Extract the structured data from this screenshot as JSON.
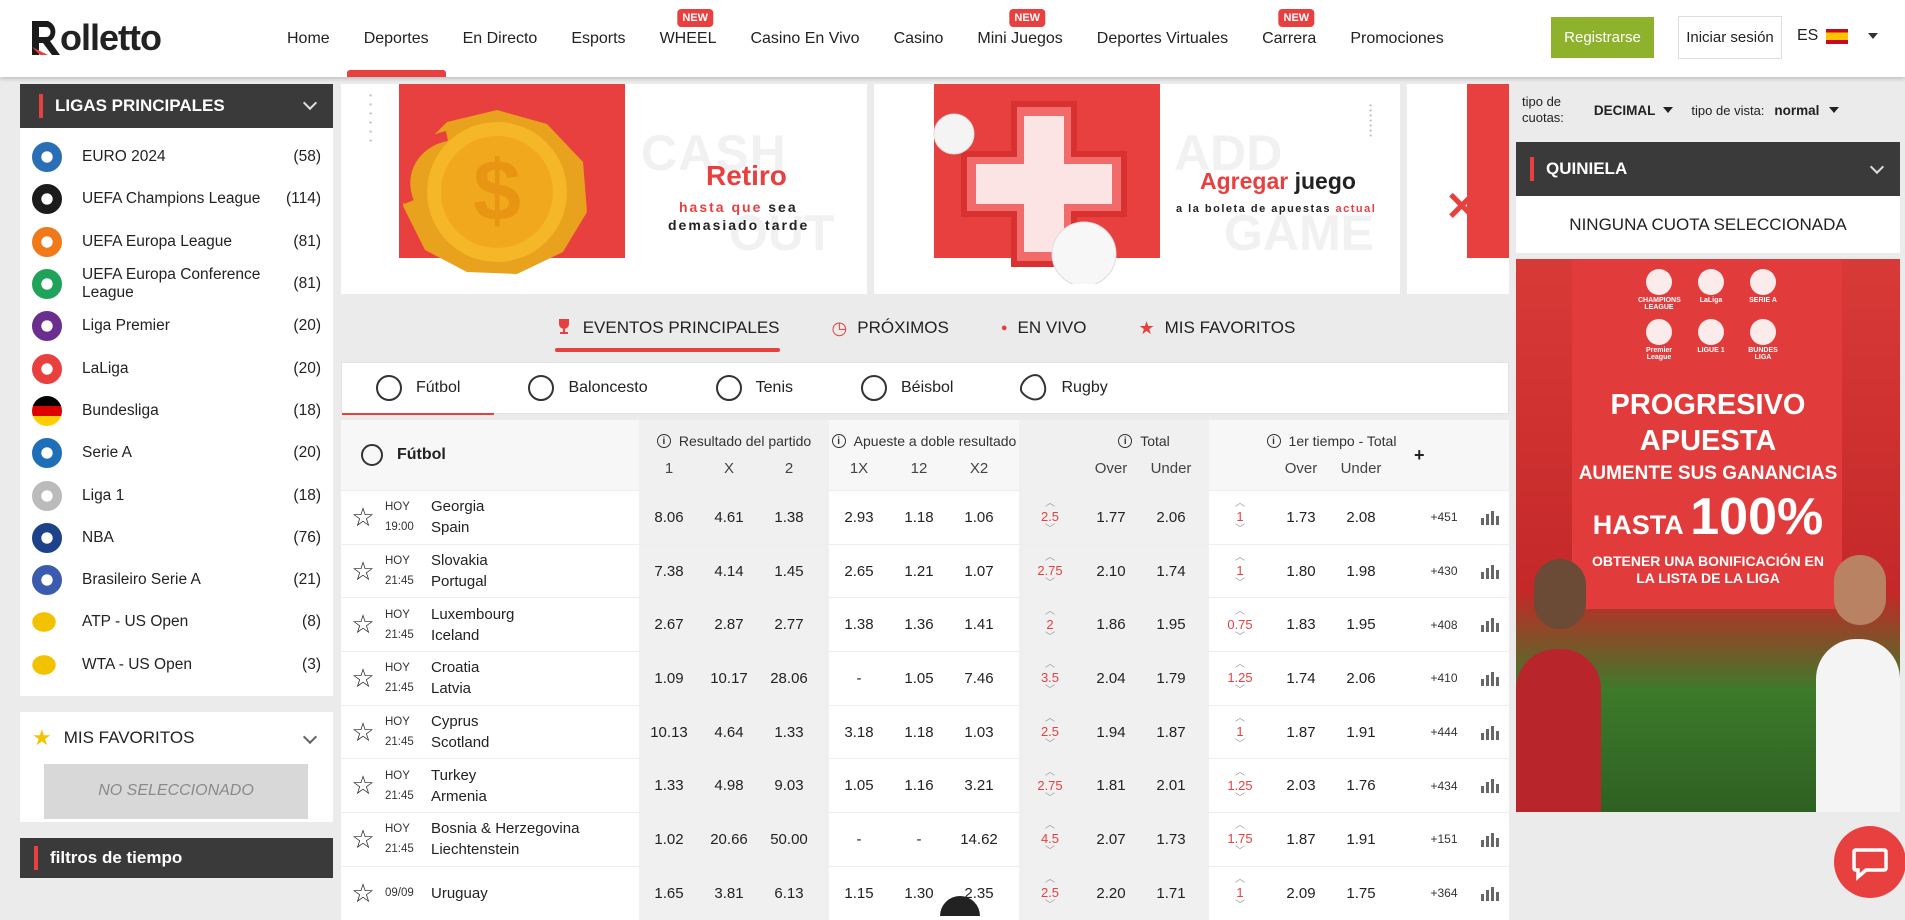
{
  "brand": {
    "logo_text": "olletto",
    "accent": "#e8403f",
    "green": "#8fb22c"
  },
  "nav": {
    "items": [
      {
        "label": "Home",
        "new": false,
        "active": false
      },
      {
        "label": "Deportes",
        "new": false,
        "active": true
      },
      {
        "label": "En Directo",
        "new": false,
        "active": false
      },
      {
        "label": "Esports",
        "new": false,
        "active": false
      },
      {
        "label": "WHEEL",
        "new": true,
        "active": false
      },
      {
        "label": "Casino En Vivo",
        "new": false,
        "active": false
      },
      {
        "label": "Casino",
        "new": false,
        "active": false
      },
      {
        "label": "Mini Juegos",
        "new": true,
        "active": false
      },
      {
        "label": "Deportes Virtuales",
        "new": false,
        "active": false
      },
      {
        "label": "Carrera",
        "new": true,
        "active": false
      },
      {
        "label": "Promociones",
        "new": false,
        "active": false
      }
    ],
    "new_badge": "NEW"
  },
  "header": {
    "register": "Registrarse",
    "login": "Iniciar sesión",
    "lang": "ES"
  },
  "leagues": {
    "title": "LIGAS PRINCIPALES",
    "items": [
      {
        "name": "EURO 2024",
        "count": "(58)",
        "icon": "euro-2024-icon",
        "color": "#2a6fb5"
      },
      {
        "name": "UEFA Champions League",
        "count": "(114)",
        "icon": "champions-league-icon",
        "color": "#1b1b1b"
      },
      {
        "name": "UEFA Europa League",
        "count": "(81)",
        "icon": "europa-league-icon",
        "color": "#f07a1a"
      },
      {
        "name": "UEFA Europa Conference League",
        "count": "(81)",
        "icon": "conference-league-icon",
        "color": "#1fa35a"
      },
      {
        "name": "Liga Premier",
        "count": "(20)",
        "icon": "premier-league-icon",
        "color": "#6a2e8f"
      },
      {
        "name": "LaLiga",
        "count": "(20)",
        "icon": "laliga-icon",
        "color": "#e8403f"
      },
      {
        "name": "Bundesliga",
        "count": "(18)",
        "icon": "germany-flag-icon",
        "color": "#dd0000"
      },
      {
        "name": "Serie A",
        "count": "(20)",
        "icon": "serie-a-icon",
        "color": "#1e6fb8"
      },
      {
        "name": "Liga 1",
        "count": "(18)",
        "icon": "ligue-1-icon",
        "color": "#bbbbbb"
      },
      {
        "name": "NBA",
        "count": "(76)",
        "icon": "nba-icon",
        "color": "#1d428a"
      },
      {
        "name": "Brasileiro Serie A",
        "count": "(21)",
        "icon": "brasileiro-icon",
        "color": "#3a5bb0"
      },
      {
        "name": "ATP - US Open",
        "count": "(8)",
        "icon": "tennis-ball-icon",
        "color": "#f2c200"
      },
      {
        "name": "WTA - US Open",
        "count": "(3)",
        "icon": "tennis-ball-icon",
        "color": "#f2c200"
      }
    ]
  },
  "favorites": {
    "title": "MIS FAVORITOS",
    "empty": "NO SELECCIONADO"
  },
  "time_filters": {
    "title": "filtros de tiempo"
  },
  "banners": {
    "b1": {
      "bg_word1": "CASH",
      "bg_word2": "OUT",
      "title": "Retiro",
      "line1a": "hasta que",
      "line1b": "sea",
      "line2": "demasiado tarde"
    },
    "b2": {
      "bg_word1": "ADD",
      "bg_word2": "GAME",
      "title_a": "Agregar",
      "title_b": "juego",
      "line1a": "a la boleta de apuestas",
      "line1b": "actual"
    }
  },
  "main_tabs": [
    {
      "label": "EVENTOS PRINCIPALES",
      "icon": "trophy-icon",
      "active": true
    },
    {
      "label": "PRÓXIMOS",
      "icon": "clock-icon",
      "active": false
    },
    {
      "label": "EN VIVO",
      "icon": "live-dot-icon",
      "active": false
    },
    {
      "label": "MIS FAVORITOS",
      "icon": "star-icon",
      "active": false
    }
  ],
  "sport_tabs": [
    {
      "label": "Fútbol",
      "icon": "soccer-ball-icon",
      "active": true
    },
    {
      "label": "Baloncesto",
      "icon": "basketball-icon",
      "active": false
    },
    {
      "label": "Tenis",
      "icon": "tennis-icon",
      "active": false
    },
    {
      "label": "Béisbol",
      "icon": "baseball-icon",
      "active": false
    },
    {
      "label": "Rugby",
      "icon": "rugby-icon",
      "active": false
    }
  ],
  "table": {
    "sport": "Fútbol",
    "g1_title": "Resultado del partido",
    "g1_cols": [
      "1",
      "X",
      "2"
    ],
    "g2_title": "Apueste a doble resultado",
    "g2_cols": [
      "1X",
      "12",
      "X2"
    ],
    "g3_title": "Total",
    "g3_cols": [
      "Over",
      "Under"
    ],
    "g4_title": "1er tiempo - Total",
    "g4_cols": [
      "Over",
      "Under"
    ],
    "plus": "+",
    "rows": [
      {
        "day": "HOY",
        "time": "19:00",
        "home": "Georgia",
        "away": "Spain",
        "o1": "8.06",
        "ox": "4.61",
        "o2": "1.38",
        "d1x": "2.93",
        "d12": "1.18",
        "dx2": "1.06",
        "tl": "2.5",
        "tover": "1.77",
        "tunder": "2.06",
        "hl": "1",
        "hover": "1.73",
        "hunder": "2.08",
        "more": "+451"
      },
      {
        "day": "HOY",
        "time": "21:45",
        "home": "Slovakia",
        "away": "Portugal",
        "o1": "7.38",
        "ox": "4.14",
        "o2": "1.45",
        "d1x": "2.65",
        "d12": "1.21",
        "dx2": "1.07",
        "tl": "2.75",
        "tover": "2.10",
        "tunder": "1.74",
        "hl": "1",
        "hover": "1.80",
        "hunder": "1.98",
        "more": "+430"
      },
      {
        "day": "HOY",
        "time": "21:45",
        "home": "Luxembourg",
        "away": "Iceland",
        "o1": "2.67",
        "ox": "2.87",
        "o2": "2.77",
        "d1x": "1.38",
        "d12": "1.36",
        "dx2": "1.41",
        "tl": "2",
        "tover": "1.86",
        "tunder": "1.95",
        "hl": "0.75",
        "hover": "1.83",
        "hunder": "1.95",
        "more": "+408"
      },
      {
        "day": "HOY",
        "time": "21:45",
        "home": "Croatia",
        "away": "Latvia",
        "o1": "1.09",
        "ox": "10.17",
        "o2": "28.06",
        "d1x": "-",
        "d12": "1.05",
        "dx2": "7.46",
        "tl": "3.5",
        "tover": "2.04",
        "tunder": "1.79",
        "hl": "1.25",
        "hover": "1.74",
        "hunder": "2.06",
        "more": "+410"
      },
      {
        "day": "HOY",
        "time": "21:45",
        "home": "Cyprus",
        "away": "Scotland",
        "o1": "10.13",
        "ox": "4.64",
        "o2": "1.33",
        "d1x": "3.18",
        "d12": "1.18",
        "dx2": "1.03",
        "tl": "2.5",
        "tover": "1.94",
        "tunder": "1.87",
        "hl": "1",
        "hover": "1.87",
        "hunder": "1.91",
        "more": "+444"
      },
      {
        "day": "HOY",
        "time": "21:45",
        "home": "Turkey",
        "away": "Armenia",
        "o1": "1.33",
        "ox": "4.98",
        "o2": "9.03",
        "d1x": "1.05",
        "d12": "1.16",
        "dx2": "3.21",
        "tl": "2.75",
        "tover": "1.81",
        "tunder": "2.01",
        "hl": "1.25",
        "hover": "2.03",
        "hunder": "1.76",
        "more": "+434"
      },
      {
        "day": "HOY",
        "time": "21:45",
        "home": "Bosnia & Herzegovina",
        "away": "Liechtenstein",
        "o1": "1.02",
        "ox": "20.66",
        "o2": "50.00",
        "d1x": "-",
        "d12": "-",
        "dx2": "14.62",
        "tl": "4.5",
        "tover": "2.07",
        "tunder": "1.73",
        "hl": "1.75",
        "hover": "1.87",
        "hunder": "1.91",
        "more": "+151"
      },
      {
        "day": "09/09",
        "time": "",
        "home": "Uruguay",
        "away": "",
        "o1": "1.65",
        "ox": "3.81",
        "o2": "6.13",
        "d1x": "1.15",
        "d12": "1.30",
        "dx2": "2.35",
        "tl": "2.5",
        "tover": "2.20",
        "tunder": "1.71",
        "hl": "1",
        "hover": "2.09",
        "hunder": "1.75",
        "more": "+364"
      }
    ]
  },
  "right": {
    "odds_type_label_1": "tipo de",
    "odds_type_label_2": "cuotas:",
    "odds_type": "DECIMAL",
    "view_label": "tipo de vista:",
    "view": "normal",
    "quiniela": "QUINIELA",
    "none_selected": "NINGUNA CUOTA SELECCIONADA",
    "promo": {
      "l1": "PROGRESIVO",
      "l2": "APUESTA",
      "l3": "AUMENTE SUS GANANCIAS",
      "l4a": "HASTA",
      "l4b": "100%",
      "l5": "OBTENER UNA BONIFICACIÓN EN",
      "l6": "LA LISTA DE LA LIGA",
      "logos": [
        "CHAMPIONS LEAGUE",
        "LaLiga",
        "SERIE A",
        "Premier League",
        "LIGUE 1",
        "BUNDES LIGA"
      ]
    }
  }
}
